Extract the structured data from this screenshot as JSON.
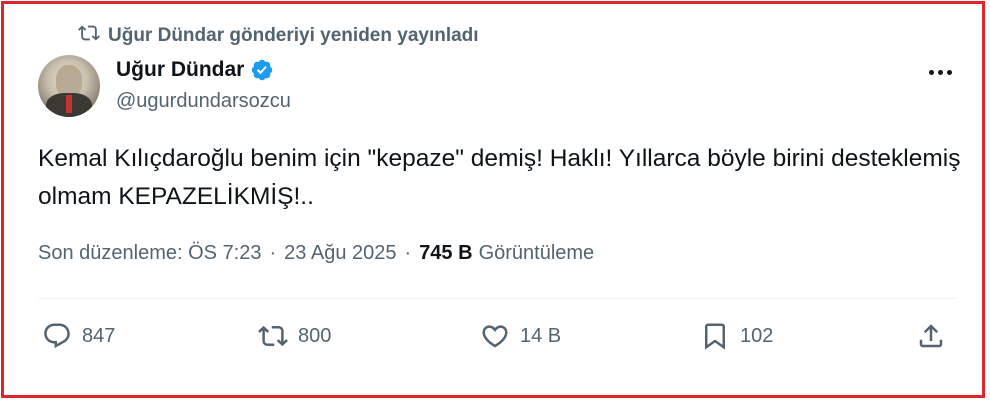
{
  "repost": {
    "text": "Uğur Dündar gönderiyi yeniden yayınladı",
    "icon": "repost-icon"
  },
  "author": {
    "name": "Uğur Dündar",
    "handle": "@ugurdundarsozcu",
    "verified": true,
    "badge_color": "#1d9bf0"
  },
  "tweet": {
    "text": "Kemal Kılıçdaroğlu benim için \"kepaze\" demiş! Haklı! Yıllarca böyle birini desteklemiş olmam KEPAZELİKMİŞ!.."
  },
  "meta": {
    "edited_label": "Son düzenleme:",
    "time": "ÖS 7:23",
    "separator": "·",
    "date": "23 Ağu 2025",
    "views_count": "745 B",
    "views_label": "Görüntüleme"
  },
  "actions": {
    "replies": "847",
    "reposts": "800",
    "likes": "14 B",
    "bookmarks": "102"
  },
  "colors": {
    "frame_border": "#e0242b",
    "secondary_text": "#536471",
    "primary_text": "#0f1419"
  }
}
